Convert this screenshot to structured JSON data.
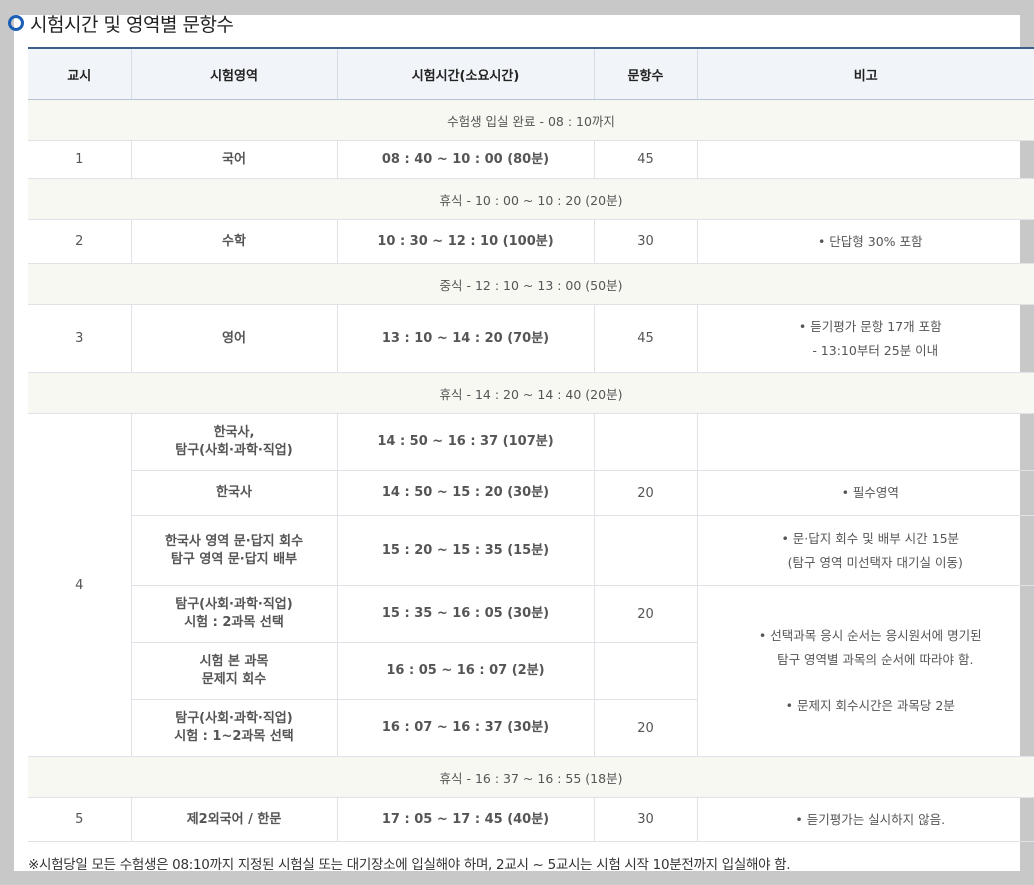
{
  "title": "시험시간 및 영역별 문항수",
  "headers": [
    "교시",
    "시험영역",
    "시험시간(소요시간)",
    "문항수",
    "비고"
  ],
  "breaks": {
    "entry": "수험생 입실 완료 - 08 : 10까지",
    "b1": "휴식 - 10 : 00 ~ 10 : 20 (20분)",
    "lunch": "중식 - 12 : 10 ~ 13 : 00 (50분)",
    "b3": "휴식 - 14 : 20 ~ 14 : 40 (20분)",
    "b4": "휴식 - 16 : 37 ~ 16 : 55 (18분)"
  },
  "rows": {
    "p1": {
      "period": "1",
      "subject": "국어",
      "time": "08 : 40 ~ 10 : 00 (80분)",
      "count": "45",
      "note": ""
    },
    "p2": {
      "period": "2",
      "subject": "수학",
      "time": "10 : 30 ~ 12 : 10 (100분)",
      "count": "30",
      "note": "• 단답형 30% 포함"
    },
    "p3": {
      "period": "3",
      "subject": "영어",
      "time": "13 : 10 ~ 14 : 20 (70분)",
      "count": "45",
      "note1": "• 듣기평가 문항 17개 포함",
      "note2": "- 13:10부터 25분 이내"
    },
    "p4": {
      "period": "4",
      "r1": {
        "subject1": "한국사,",
        "subject2": "탐구(사회·과학·직업)",
        "time": "14 : 50 ~ 16 : 37 (107분)",
        "count": ""
      },
      "r2": {
        "subject": "한국사",
        "time": "14 : 50 ~ 15 : 20 (30분)",
        "count": "20",
        "note": "• 필수영역"
      },
      "r3": {
        "subject1": "한국사 영역 문·답지 회수",
        "subject2": "탐구 영역 문·답지 배부",
        "time": "15 : 20 ~ 15 : 35 (15분)",
        "count": "",
        "note1": "• 문·답지 회수 및 배부 시간 15분",
        "note2": "(탐구 영역 미선택자 대기실 이동)"
      },
      "r4": {
        "subject1": "탐구(사회·과학·직업)",
        "subject2": "시험 : 2과목 선택",
        "time": "15 : 35 ~ 16 : 05 (30분)",
        "count": "20"
      },
      "r5": {
        "subject1": "시험 본 과목",
        "subject2": "문제지 회수",
        "time": "16 : 05 ~ 16 : 07 (2분)",
        "count": ""
      },
      "r6": {
        "subject1": "탐구(사회·과학·직업)",
        "subject2": "시험 : 1~2과목 선택",
        "time": "16 : 07 ~ 16 : 37 (30분)",
        "count": "20"
      },
      "note_a1": "• 선택과목 응시 순서는 응시원서에 명기된",
      "note_a2": "탐구 영역별 과목의 순서에 따라야 함.",
      "note_b": "• 문제지 회수시간은 과목당 2분"
    },
    "p5": {
      "period": "5",
      "subject": "제2외국어 / 한문",
      "time": "17 : 05 ~ 17 : 45 (40분)",
      "count": "30",
      "note": "• 듣기평가는 실시하지 않음."
    }
  },
  "footer": "※시험당일 모든 수험생은 08:10까지 지정된 시험실 또는 대기장소에 입실해야 하며, 2교시 ~ 5교시는 시험 시작 10분전까지 입실해야 함.",
  "colors": {
    "accent": "#1a5fb4",
    "subject_text": "#1f4f86",
    "break_bg": "#f8f8f3"
  }
}
